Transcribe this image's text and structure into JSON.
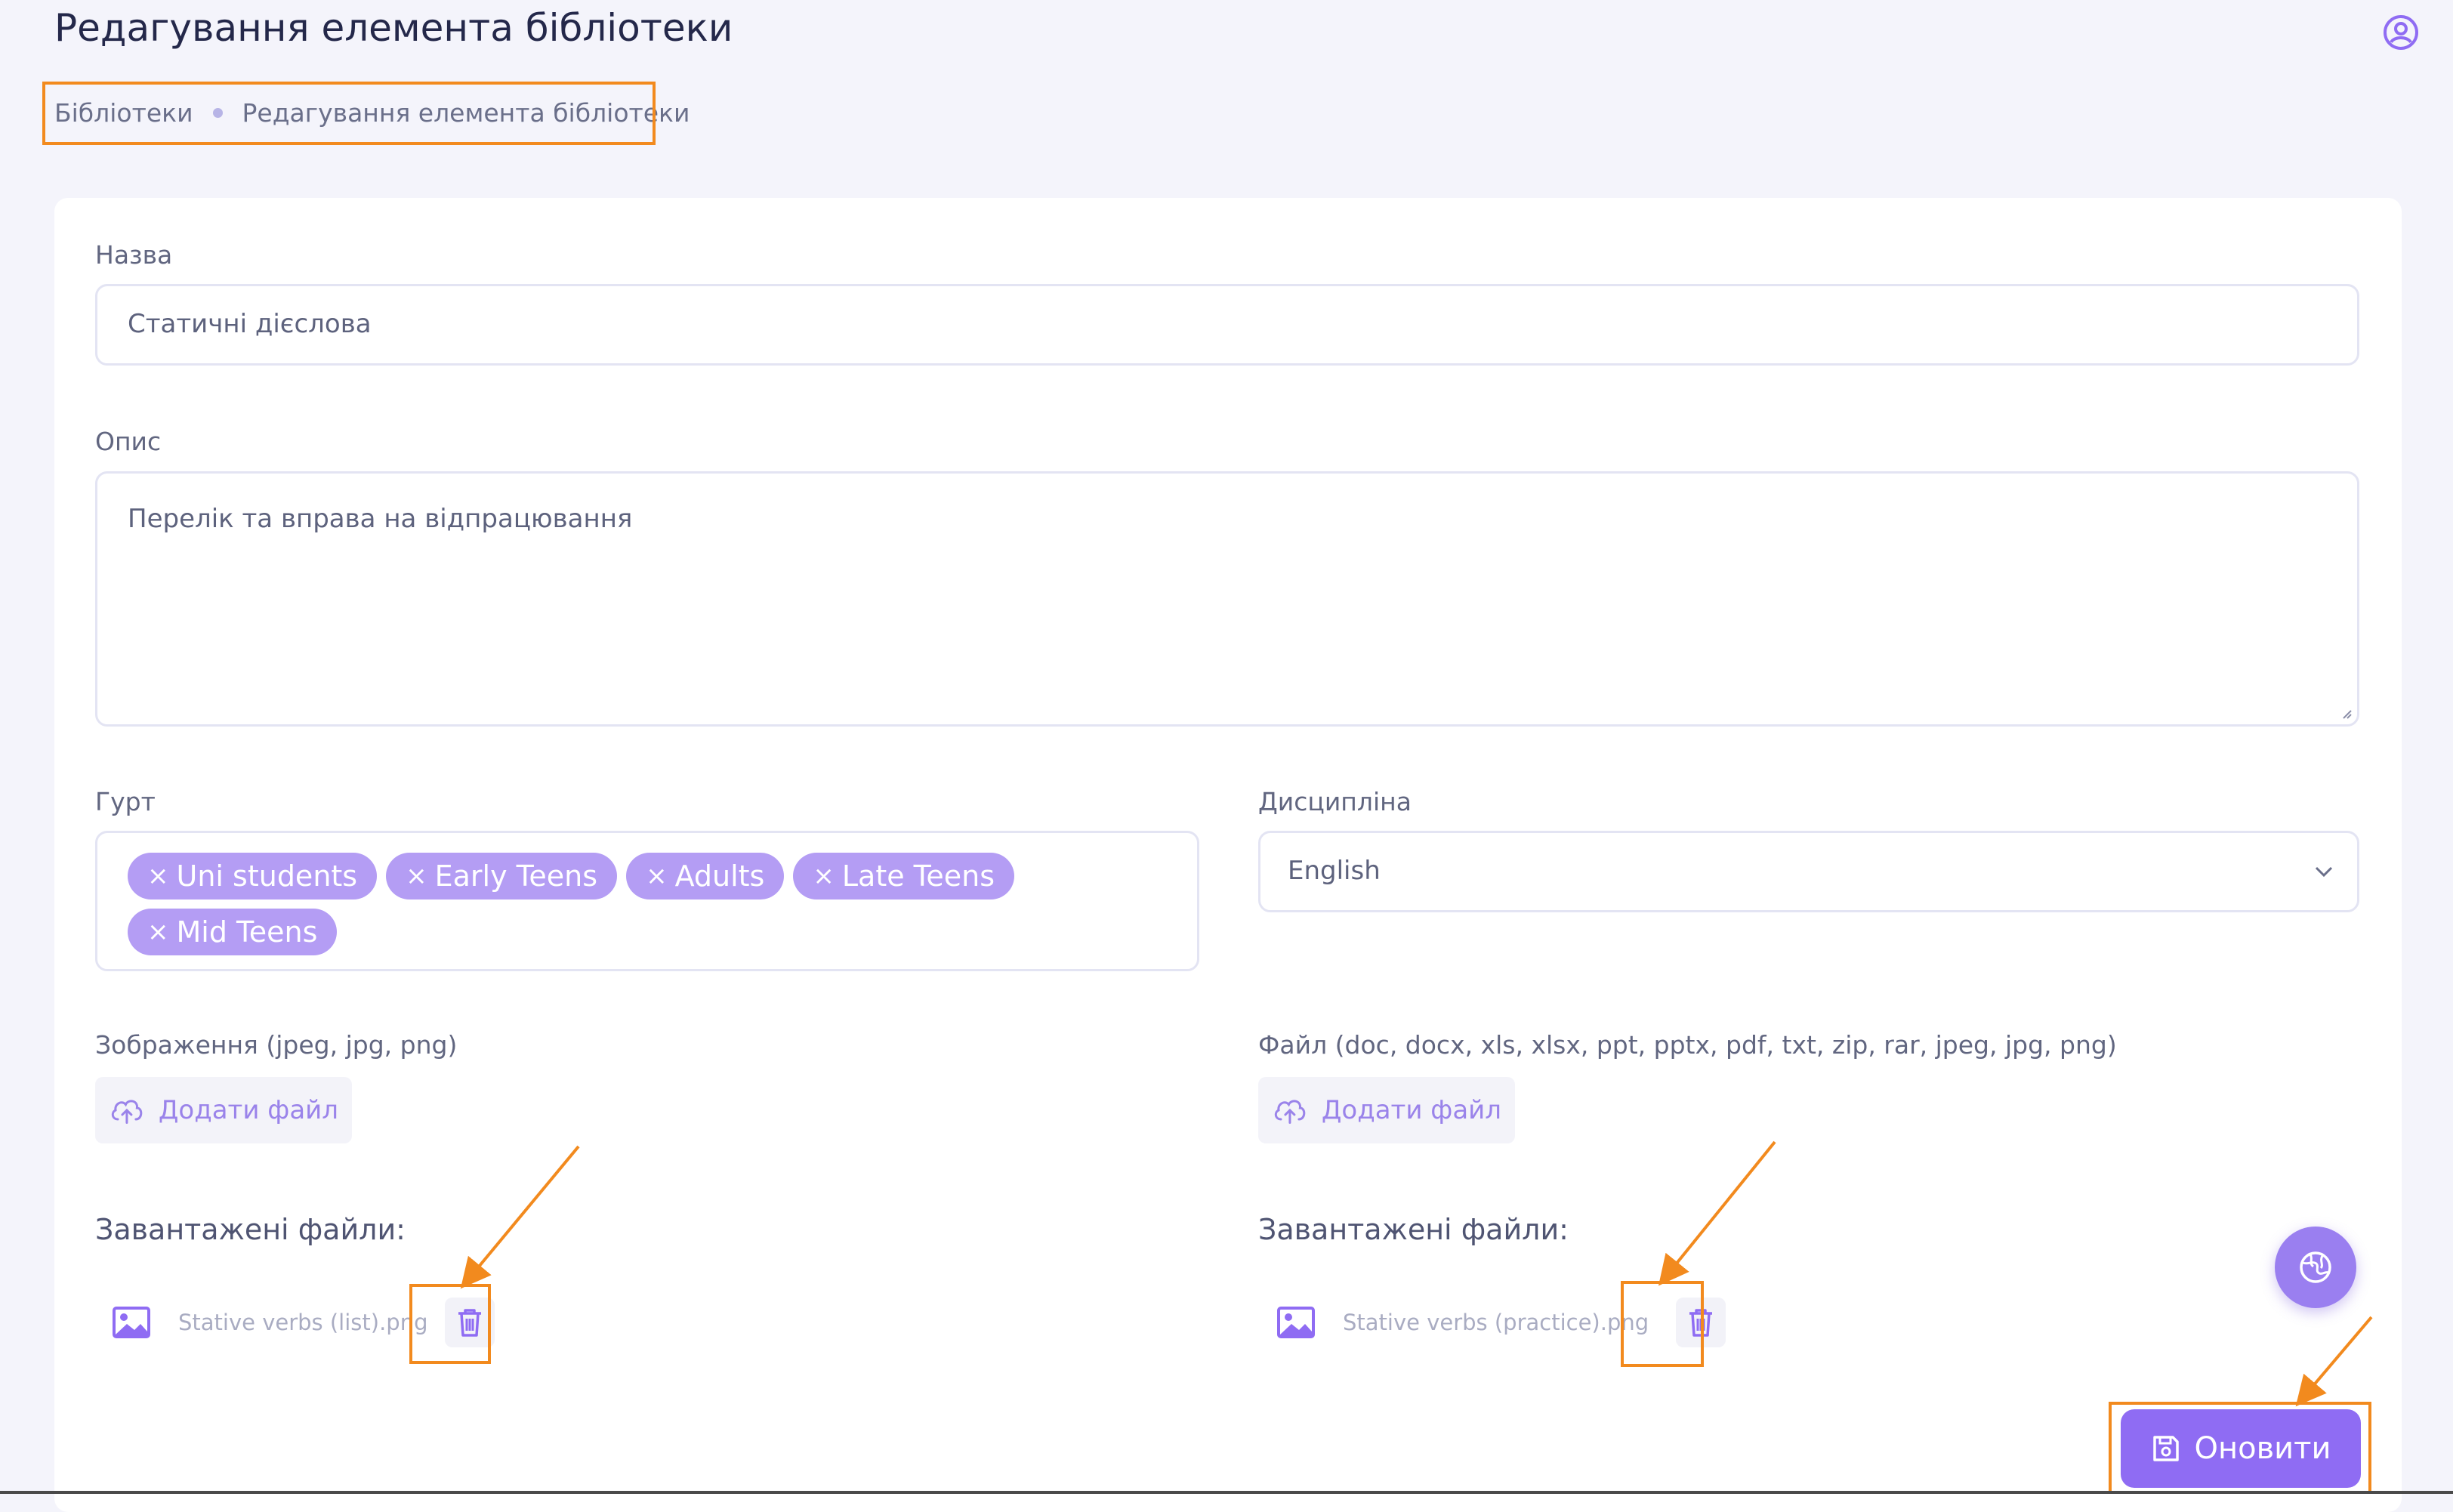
{
  "header": {
    "title": "Редагування елемента бібліотеки",
    "user_icon": "user-circle-icon"
  },
  "breadcrumb": {
    "items": [
      "Бібліотеки",
      "Редагування елемента бібліотеки"
    ]
  },
  "form": {
    "name": {
      "label": "Назва",
      "value": "Статичні дієслова"
    },
    "description": {
      "label": "Опис",
      "value": "Перелік та вправа на відпрацювання"
    },
    "group": {
      "label": "Гурт",
      "tags": [
        "Uni students",
        "Early Teens",
        "Adults",
        "Late Teens",
        "Mid Teens"
      ],
      "remove_symbol": "×"
    },
    "discipline": {
      "label": "Дисципліна",
      "value": "English"
    },
    "image_upload": {
      "label": "Зображення (jpeg, jpg, png)",
      "button": "Додати файл",
      "uploaded_heading": "Завантажені файли:",
      "files": [
        "Stative verbs (list).png"
      ]
    },
    "file_upload": {
      "label": "Файл (doc, docx, xls, xlsx, ppt, pptx, pdf, txt, zip, rar, jpeg, jpg, png)",
      "button": "Додати файл",
      "uploaded_heading": "Завантажені файли:",
      "files": [
        "Stative verbs (practice).png"
      ]
    },
    "submit": "Оновити"
  },
  "colors": {
    "accent": "#8f6cf3",
    "chip": "#b49df4",
    "annotation": "#f28a1e"
  }
}
